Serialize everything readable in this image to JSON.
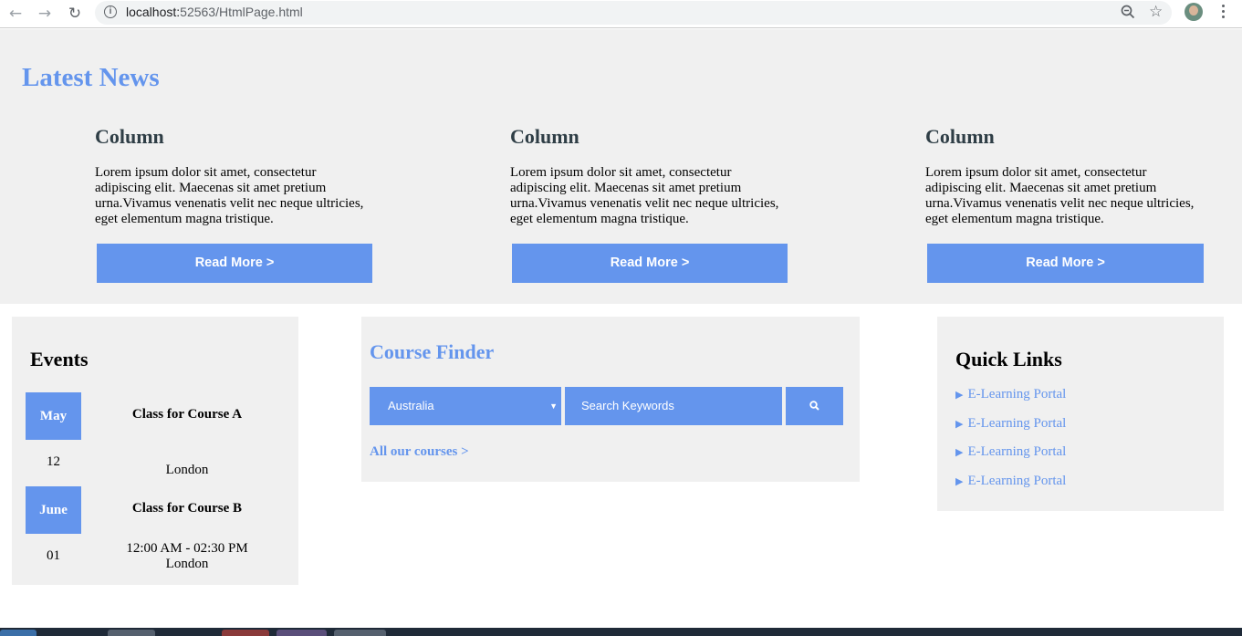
{
  "browser": {
    "url_host": "localhost:",
    "url_path": "52563/HtmlPage.html"
  },
  "news": {
    "title": "Latest News",
    "columns": [
      {
        "heading": "Column",
        "text": "Lorem ipsum dolor sit amet, consectetur adipiscing elit. Maecenas sit amet pretium urna.Vivamus venenatis velit nec neque ultricies, eget elementum magna tristique.",
        "button": "Read More >"
      },
      {
        "heading": "Column",
        "text": "Lorem ipsum dolor sit amet, consectetur adipiscing elit. Maecenas sit amet pretium urna.Vivamus venenatis velit nec neque ultricies, eget elementum magna tristique.",
        "button": "Read More >"
      },
      {
        "heading": "Column",
        "text": "Lorem ipsum dolor sit amet, consectetur adipiscing elit. Maecenas sit amet pretium urna.Vivamus venenatis velit nec neque ultricies, eget elementum magna tristique.",
        "button": "Read More >"
      }
    ]
  },
  "events": {
    "title": "Events",
    "items": [
      {
        "month": "May",
        "day": "12",
        "title": "Class for Course A",
        "time": "",
        "location": "London"
      },
      {
        "month": "June",
        "day": "01",
        "title": "Class for Course B",
        "time": "12:00 AM - 02:30 PM",
        "location": "London"
      }
    ]
  },
  "finder": {
    "title": "Course Finder",
    "country": "Australia",
    "search_placeholder": "Search Keywords",
    "all_courses": "All our courses >"
  },
  "quick_links": {
    "title": "Quick Links",
    "items": [
      "E-Learning Portal",
      "E-Learning Portal",
      "E-Learning Portal",
      "E-Learning Portal"
    ]
  },
  "colors": {
    "accent": "#6495ed",
    "panel": "#f0f0f0",
    "heading_dark": "#2f3e46"
  }
}
